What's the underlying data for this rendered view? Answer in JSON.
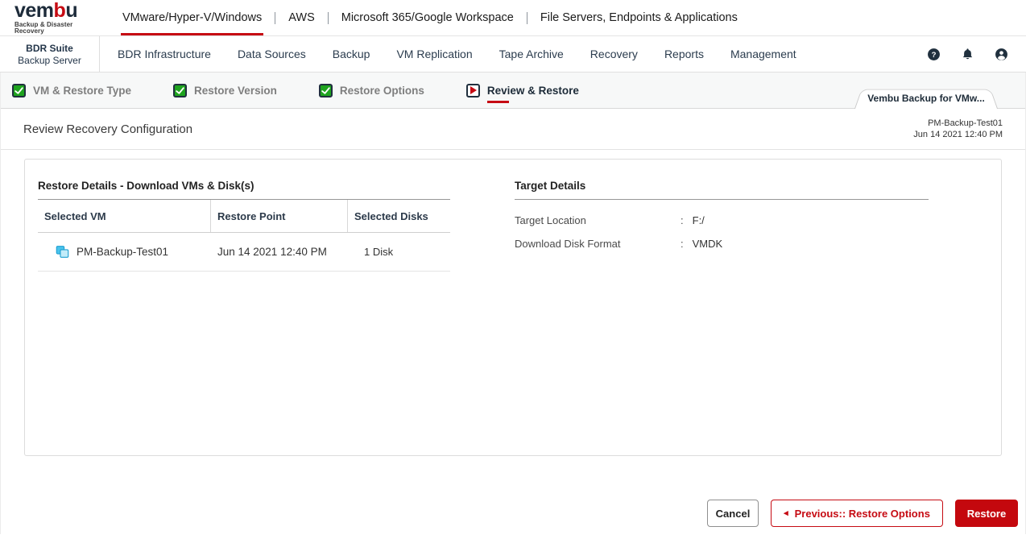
{
  "brand": {
    "logo_pre": "vem",
    "logo_accent": "b",
    "logo_post": "u",
    "tagline": "Backup & Disaster Recovery"
  },
  "product_nav": {
    "items": [
      {
        "label": "VMware/Hyper-V/Windows",
        "active": true
      },
      {
        "label": "AWS",
        "active": false
      },
      {
        "label": "Microsoft 365/Google Workspace",
        "active": false
      },
      {
        "label": "File Servers, Endpoints & Applications",
        "active": false
      }
    ]
  },
  "server_nav": {
    "badge_line1": "BDR Suite",
    "badge_line2": "Backup Server",
    "items": [
      "BDR Infrastructure",
      "Data Sources",
      "Backup",
      "VM Replication",
      "Tape Archive",
      "Recovery",
      "Reports",
      "Management"
    ],
    "icons": [
      "help-icon",
      "notifications-icon",
      "account-icon"
    ]
  },
  "wizard": {
    "steps": [
      {
        "label": "VM & Restore Type",
        "state": "done"
      },
      {
        "label": "Restore Version",
        "state": "done"
      },
      {
        "label": "Restore Options",
        "state": "done"
      },
      {
        "label": "Review & Restore",
        "state": "active"
      }
    ],
    "context_tab": "Vembu Backup for VMw..."
  },
  "page": {
    "title": "Review Recovery Configuration",
    "meta_line1": "PM-Backup-Test01",
    "meta_line2": "Jun 14 2021 12:40 PM"
  },
  "restore_details": {
    "title": "Restore Details - Download VMs & Disk(s)",
    "columns": [
      "Selected VM",
      "Restore Point",
      "Selected Disks"
    ],
    "rows": [
      {
        "vm": "PM-Backup-Test01",
        "restore_point": "Jun 14 2021 12:40 PM",
        "disks": "1 Disk"
      }
    ]
  },
  "target_details": {
    "title": "Target Details",
    "colon": ":",
    "rows": [
      {
        "label": "Target Location",
        "value": "F:/"
      },
      {
        "label": "Download Disk Format",
        "value": "VMDK"
      }
    ]
  },
  "footer": {
    "cancel_label": "Cancel",
    "previous_arrow": "◂",
    "previous_label": "Previous:: Restore Options",
    "restore_label": "Restore"
  },
  "colors": {
    "accent_red": "#c60b13",
    "step_green": "#1fa41f",
    "navy": "#24364a"
  }
}
